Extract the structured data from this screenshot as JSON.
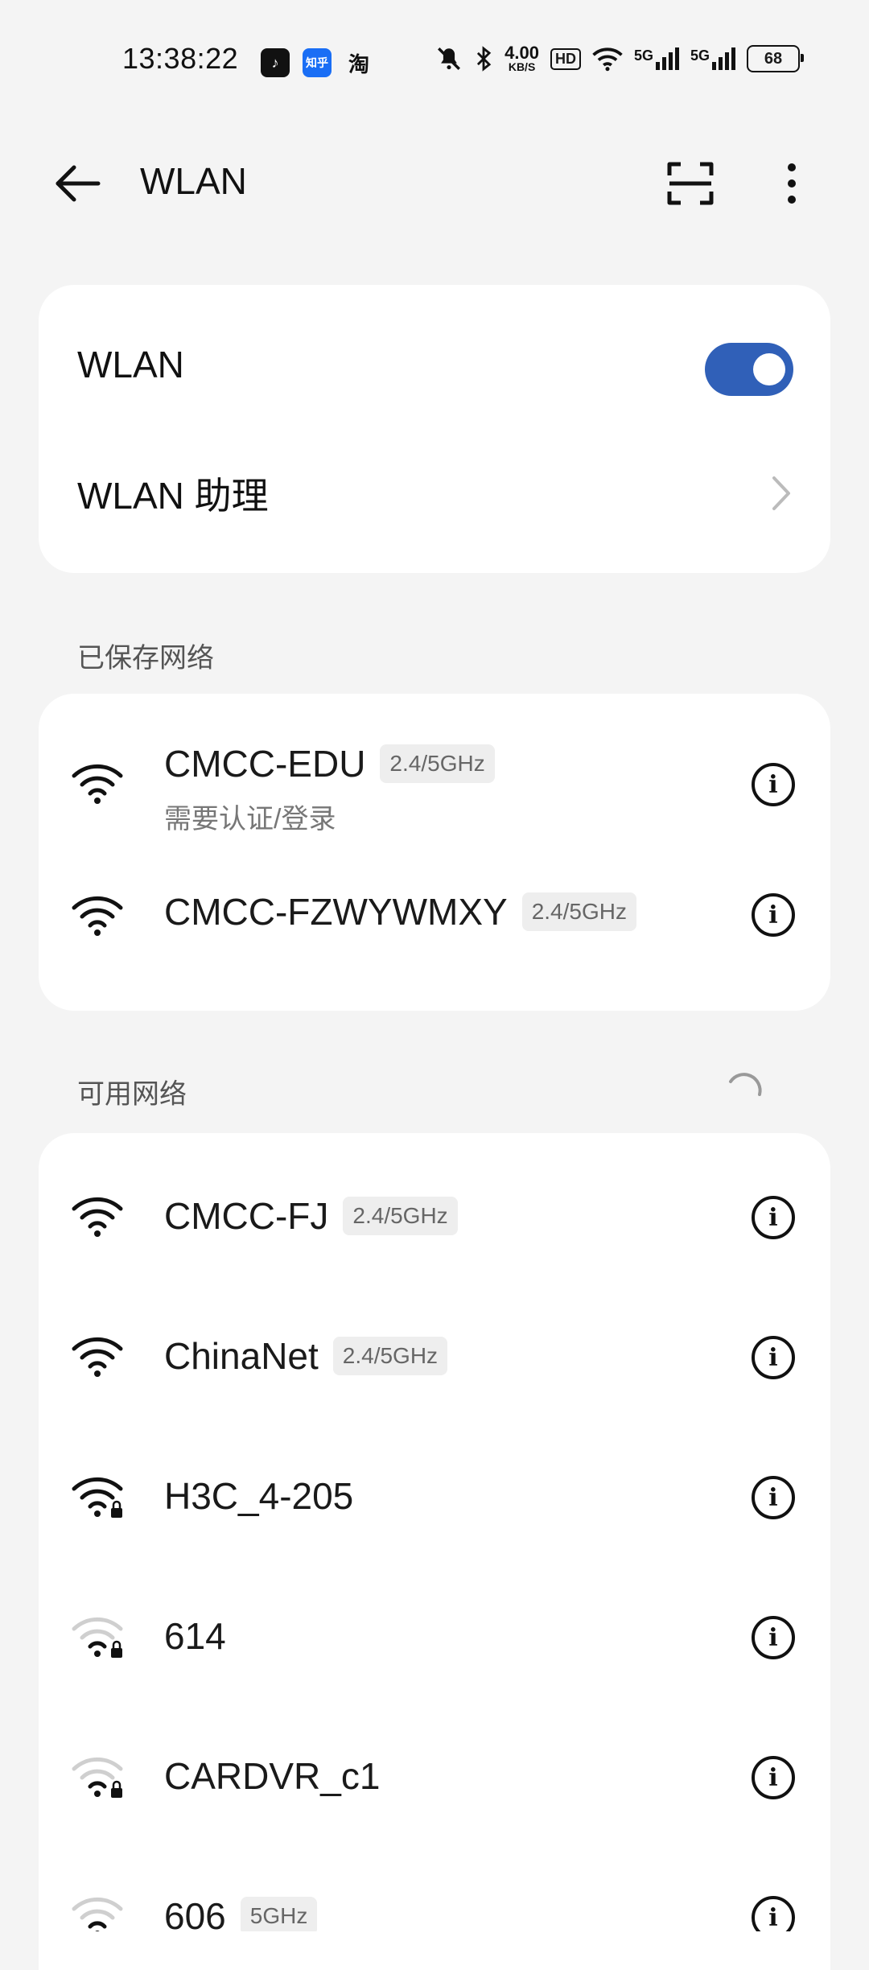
{
  "status_bar": {
    "time": "13:38:22",
    "apps": [
      "tiktok-icon",
      "zhihu-icon",
      "taobao-icon"
    ],
    "zhihu_text": "知乎",
    "taobao_text": "淘",
    "speed_value": "4.00",
    "speed_unit": "KB/S",
    "hd_label": "HD",
    "sim1": "5G",
    "sim2": "5G",
    "battery": "68"
  },
  "header": {
    "title": "WLAN",
    "icons": [
      "back-arrow-icon",
      "scan-icon",
      "more-vertical-icon"
    ]
  },
  "toggle_card": {
    "wlan_label": "WLAN",
    "wlan_enabled": true,
    "assistant_label": "WLAN 助理"
  },
  "saved_section": {
    "title": "已保存网络",
    "networks": [
      {
        "name": "CMCC-EDU",
        "band": "2.4/5GHz",
        "status": "需要认证/登录",
        "locked": false
      },
      {
        "name": "CMCC-FZWYWMXY",
        "band": "2.4/5GHz",
        "status": "",
        "locked": false
      }
    ]
  },
  "available_section": {
    "title": "可用网络",
    "networks": [
      {
        "name": "CMCC-FJ",
        "band": "2.4/5GHz",
        "locked": false
      },
      {
        "name": "ChinaNet",
        "band": "2.4/5GHz",
        "locked": false
      },
      {
        "name": "H3C_4-205",
        "band": "",
        "locked": true
      },
      {
        "name": "614",
        "band": "",
        "locked": true
      },
      {
        "name": "CARDVR_c1",
        "band": "",
        "locked": true
      },
      {
        "name": "606",
        "band": "5GHz",
        "locked": true
      }
    ]
  },
  "colors": {
    "accent": "#3060b8",
    "background": "#f4f4f4",
    "card": "#ffffff"
  }
}
